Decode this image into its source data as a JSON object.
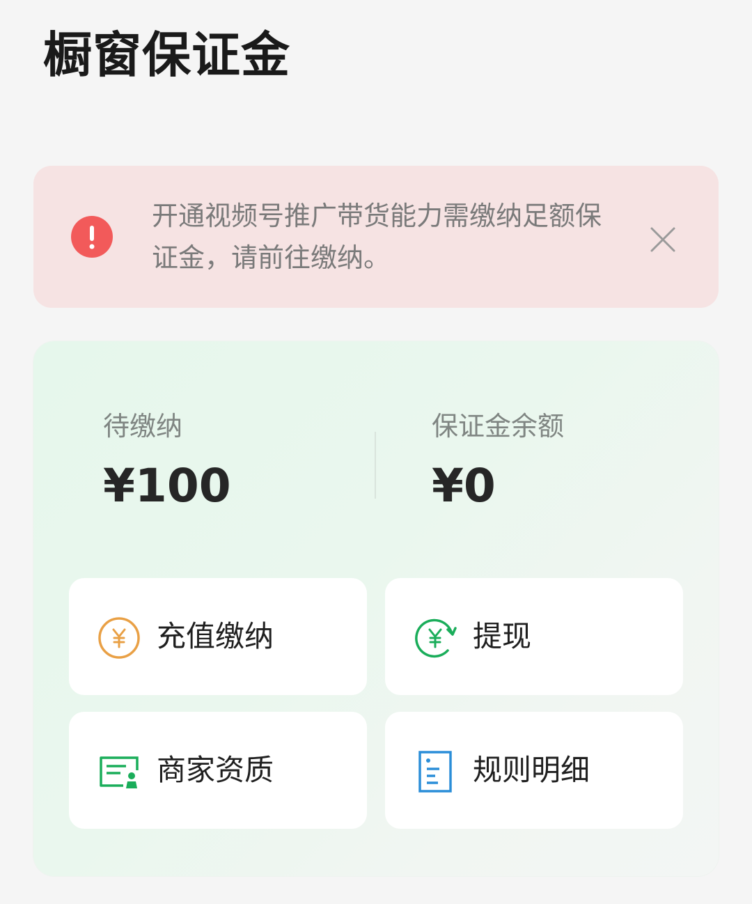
{
  "page": {
    "title": "橱窗保证金"
  },
  "alert": {
    "message": "开通视频号推广带货能力需缴纳足额保证金，请前往缴纳。",
    "icon": "exclamation-icon",
    "close_icon": "close-icon",
    "color": "#f25a5a"
  },
  "summary": {
    "pending": {
      "label": "待缴纳",
      "value": "¥100"
    },
    "balance": {
      "label": "保证金余额",
      "value": "¥0"
    }
  },
  "actions": [
    {
      "label": "充值缴纳",
      "icon": "yuan-circle-icon",
      "color": "#e9a045"
    },
    {
      "label": "提现",
      "icon": "yuan-refresh-icon",
      "color": "#1aad5a"
    },
    {
      "label": "商家资质",
      "icon": "certificate-icon",
      "color": "#1aad5a"
    },
    {
      "label": "规则明细",
      "icon": "document-icon",
      "color": "#2b8ed8"
    }
  ]
}
